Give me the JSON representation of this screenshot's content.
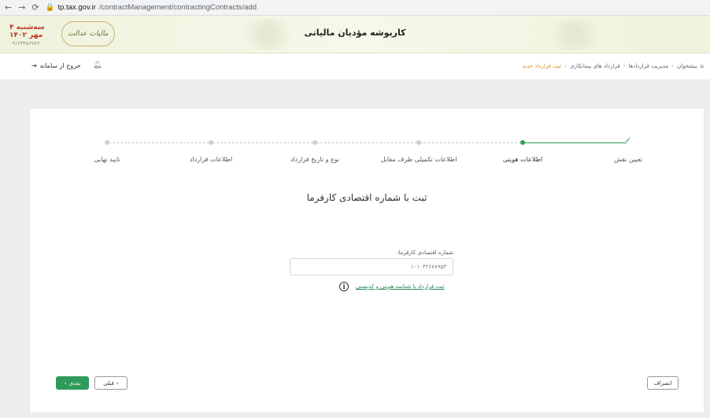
{
  "browser": {
    "back_icon": "arrow-left-icon",
    "forward_icon": "arrow-right-icon",
    "reload_icon": "reload-icon",
    "lock_icon": "lock-icon",
    "url_host": "tp.tax.gov.ir",
    "url_path": "/contractManagement/contractingContracts/add"
  },
  "header": {
    "title": "کارپوشه مؤدیان مالیاتی",
    "date": "سه‌شنبه ۴ مهر ۱۴۰۲",
    "date_sub": "۰۹۱۲۳۴۵۶۷۸۹",
    "logo_text": "مالیات عدالت"
  },
  "subbar": {
    "breadcrumb": [
      "پیشخوان",
      "مدیریت قراردادها",
      "قرارداد های پیمانکاری",
      "ثبت قرارداد جدید"
    ],
    "logout_label": "خروج از سامانه",
    "logout_icon": "logout-icon",
    "bell_icon": "bell-icon",
    "home_icon": "home-icon"
  },
  "stepper": {
    "steps": [
      {
        "label": "تعیین نقش",
        "state": "done"
      },
      {
        "label": "اطلاعات هویتی",
        "state": "active"
      },
      {
        "label": "اطلاعات تکمیلی طرف مقابل",
        "state": "pending"
      },
      {
        "label": "نوع و تاریخ قرارداد",
        "state": "pending"
      },
      {
        "label": "اطلاعات قرارداد",
        "state": "pending"
      },
      {
        "label": "تایید نهایی",
        "state": "pending"
      }
    ]
  },
  "form": {
    "title": "ثبت با شماره اقتصادی کارفرما",
    "field_label": "شماره اقتصادی کارفرما:",
    "field_value": "۱۰۱۰۴۲۶۷۸۹۵۳",
    "alt_link": "ثبت قرارداد با شناسه هویتی و کدپستی"
  },
  "buttons": {
    "next": "بعدی",
    "prev": "قبلی",
    "cancel": "انصراف"
  },
  "colors": {
    "accent": "#2e9b5b",
    "breadcrumb_current": "#e08a2b",
    "date": "#c0392b"
  }
}
